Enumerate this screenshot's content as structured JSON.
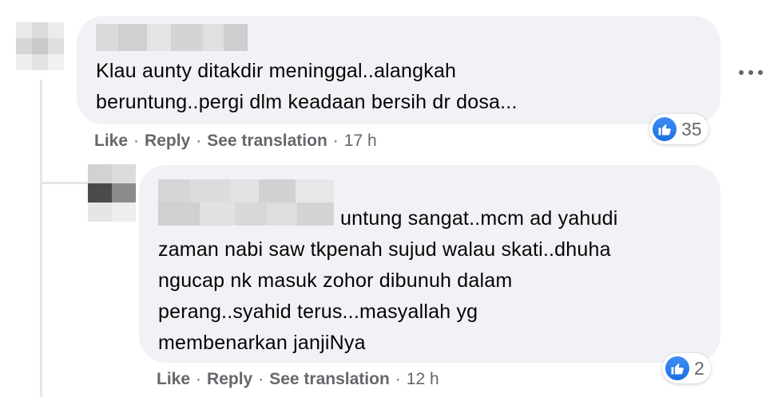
{
  "comments": [
    {
      "text_lines": [
        "Klau aunty ditakdir meninggal..alangkah",
        "beruntung..pergi dlm keadaan bersih dr dosa..."
      ],
      "actions": {
        "like": "Like",
        "reply": "Reply",
        "translate": "See translation",
        "time": "17 h",
        "separator": "·"
      },
      "reactions": {
        "icon": "thumbs-up-icon",
        "count": "35"
      }
    },
    {
      "text_lines": [
        "untung sangat..mcm ad yahudi",
        "zaman nabi saw tkpenah sujud walau skati..dhuha",
        "ngucap nk masuk zohor dibunuh dalam",
        "perang..syahid terus...masyallah yg",
        "membenarkan janjiNya"
      ],
      "actions": {
        "like": "Like",
        "reply": "Reply",
        "translate": "See translation",
        "time": "12 h",
        "separator": "·"
      },
      "reactions": {
        "icon": "thumbs-up-icon",
        "count": "2"
      }
    }
  ],
  "more_menu": {
    "icon": "more-options-icon"
  },
  "colors": {
    "bubble": "#f0f2f5",
    "meta_text": "#65676b",
    "like_blue": "#1b74e4",
    "thread_line": "#e4e6eb"
  }
}
